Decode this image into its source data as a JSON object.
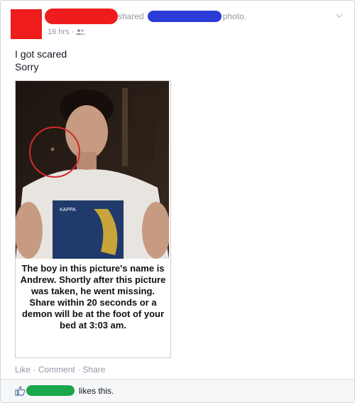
{
  "header": {
    "shared_label": "shared",
    "photo_label": "photo.",
    "timestamp": "16 hrs",
    "privacy_icon": "friends-icon",
    "redaction_red": "#ee1c1c",
    "redaction_blue": "#2b3bd6"
  },
  "post": {
    "line1": "I got scared",
    "line2": "Sorry"
  },
  "photo": {
    "shirt_text": "KAPPA",
    "caption": "The boy in this picture's name is Andrew. Shortly after this picture was taken, he went missing. Share within 20 seconds or a demon will be at the foot of your bed at 3:03 am."
  },
  "actions": {
    "like": "Like",
    "comment": "Comment",
    "share": "Share",
    "separator": "·"
  },
  "likes": {
    "text": "likes this.",
    "redaction_green": "#1aa64a",
    "thumb_icon": "thumbs-up-icon"
  }
}
